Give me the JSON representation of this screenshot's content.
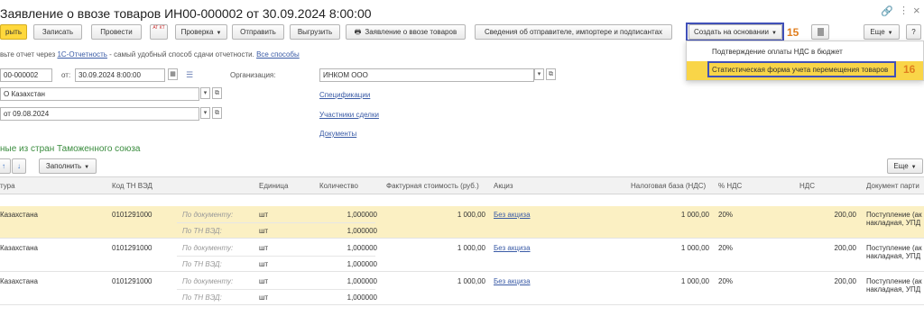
{
  "header": {
    "title": "Заявление о ввозе товаров ИН00-000002 от 30.09.2024 8:00:00",
    "link_icon": "link-icon",
    "more_icon": "more-vertical-icon",
    "close_icon": "close-icon"
  },
  "toolbar": {
    "post_close": "рыть",
    "save": "Записать",
    "post": "Провести",
    "at_kt": "АТ КТ",
    "check": "Проверка",
    "send": "Отправить",
    "upload": "Выгрузить",
    "print_application": "Заявление о ввозе товаров",
    "sender_info": "Сведения об отправителе, импортере и подписантах",
    "create_based_on": "Создать на основании",
    "more": "Еще",
    "help": "?"
  },
  "annotations": {
    "n15": "15",
    "n16": "16"
  },
  "dropdown": {
    "items": [
      "Подтверждение оплаты НДС в бюджет",
      "Статистическая форма учета перемещения товаров"
    ]
  },
  "info": {
    "prefix": "вьте отчет через ",
    "link1": "1С-Отчетность",
    "middle": " - самый удобный способ сдачи отчетности. ",
    "link2": "Все способы"
  },
  "form": {
    "number": "00-000002",
    "date_label": "от:",
    "date": "30.09.2024  8:00:00",
    "org_label": "Организация:",
    "org": "ИНКОМ ООО",
    "country": "О Казахстан",
    "contract": "от 09.08.2024",
    "spec_link": "Спецификации",
    "participants_link": "Участники сделки",
    "documents_link": "Документы"
  },
  "section": {
    "title": "ные из стран Таможенного союза",
    "fill": "Заполнить",
    "more": "Еще"
  },
  "table": {
    "columns": [
      "тура",
      "Код ТН ВЭД",
      "Единица",
      "Количество",
      "Фактурная стоимость (руб.)",
      "Акциз",
      "Налоговая база (НДС)",
      "% НДС",
      "НДС",
      "Документ парти"
    ],
    "rows": [
      {
        "name": "Казахстана",
        "code": "0101291000",
        "by_doc": "По документу:",
        "by_tn": "По ТН ВЭД:",
        "unit1": "шт",
        "unit2": "шт",
        "qty1": "1,000000",
        "qty2": "1,000000",
        "invoice": "1 000,00",
        "excise": "Без акциза",
        "tax_base": "1 000,00",
        "vat_rate": "20%",
        "vat": "200,00",
        "doc1": "Поступление (ак",
        "doc2": "накладная, УПД"
      },
      {
        "name": "Казахстана",
        "code": "0101291000",
        "by_doc": "По документу:",
        "by_tn": "По ТН ВЭД:",
        "unit1": "шт",
        "unit2": "шт",
        "qty1": "1,000000",
        "qty2": "1,000000",
        "invoice": "1 000,00",
        "excise": "Без акциза",
        "tax_base": "1 000,00",
        "vat_rate": "20%",
        "vat": "200,00",
        "doc1": "Поступление (ак",
        "doc2": "накладная, УПД"
      },
      {
        "name": "Казахстана",
        "code": "0101291000",
        "by_doc": "По документу:",
        "by_tn": "По ТН ВЭД:",
        "unit1": "шт",
        "unit2": "шт",
        "qty1": "1,000000",
        "qty2": "1,000000",
        "invoice": "1 000,00",
        "excise": "Без акциза",
        "tax_base": "1 000,00",
        "vat_rate": "20%",
        "vat": "200,00",
        "doc1": "Поступление (ак",
        "doc2": "накладная, УПД"
      }
    ]
  }
}
